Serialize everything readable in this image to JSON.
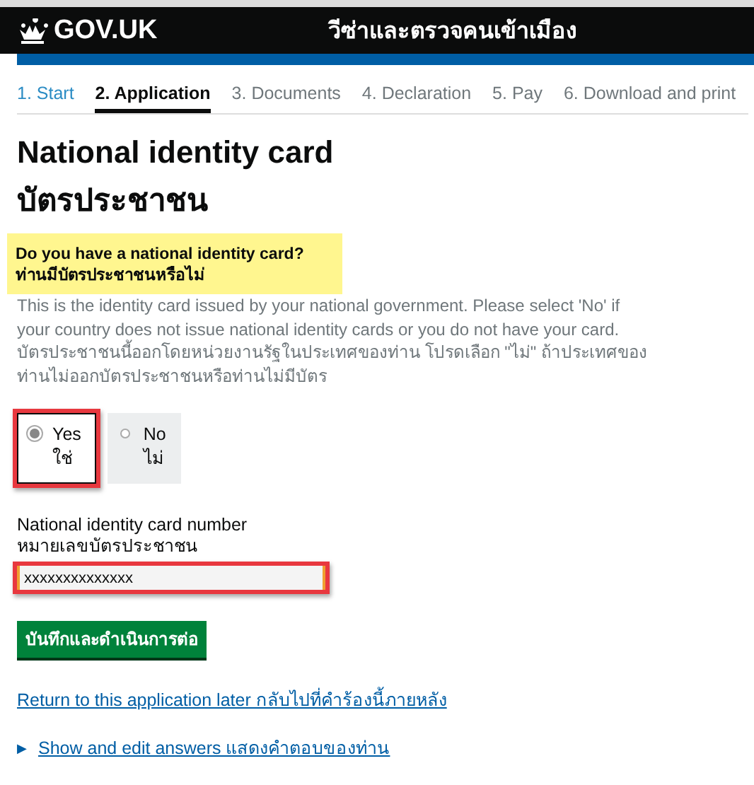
{
  "header": {
    "logo": "GOV.UK",
    "title": "วีซ่าและตรวจคนเข้าเมือง"
  },
  "steps": [
    {
      "label": "1. Start",
      "completed": true,
      "selected": false
    },
    {
      "label": "2. Application",
      "completed": false,
      "selected": true
    },
    {
      "label": "3. Documents",
      "completed": false,
      "selected": false
    },
    {
      "label": "4. Declaration",
      "completed": false,
      "selected": false
    },
    {
      "label": "5. Pay",
      "completed": false,
      "selected": false
    },
    {
      "label": "6. Download and print",
      "completed": false,
      "selected": false
    }
  ],
  "heading": [
    "National identity card",
    "บัตรประชาชน"
  ],
  "question": {
    "lines": [
      "Do you have a national identity card?",
      "ท่านมีบัตรประชาชนหรือไม่"
    ],
    "highlighted": true
  },
  "hint": [
    "This is the identity card issued by your national government. Please select 'No' if your country does not issue national identity cards or you do not have your card.",
    "บัตรประชาชนนี้ออกโดยหน่วยงานรัฐในประเทศของท่าน โปรดเลือก \"ไม่\" ถ้าประเทศของท่านไม่ออกบัตรประชาชนหรือท่านไม่มีบัตร"
  ],
  "options": [
    {
      "label": "Yes",
      "label_th": "ใช่",
      "selected": true,
      "highlighted": true
    },
    {
      "label": "No",
      "label_th": "ไม่",
      "selected": false,
      "highlighted": false
    }
  ],
  "field": {
    "label": "National identity card number",
    "label_th": "หมายเลขบัตรประชาชน",
    "value": "xxxxxxxxxxxxxx",
    "highlighted": true
  },
  "button": "บันทึกและดำเนินการต่อ",
  "return_link": "Return to this application later กลับไปที่คำร้องนี้ภายหลัง",
  "details": {
    "toggle": "▶",
    "label": "Show and edit answers แสดงคำตอบของท่าน"
  }
}
